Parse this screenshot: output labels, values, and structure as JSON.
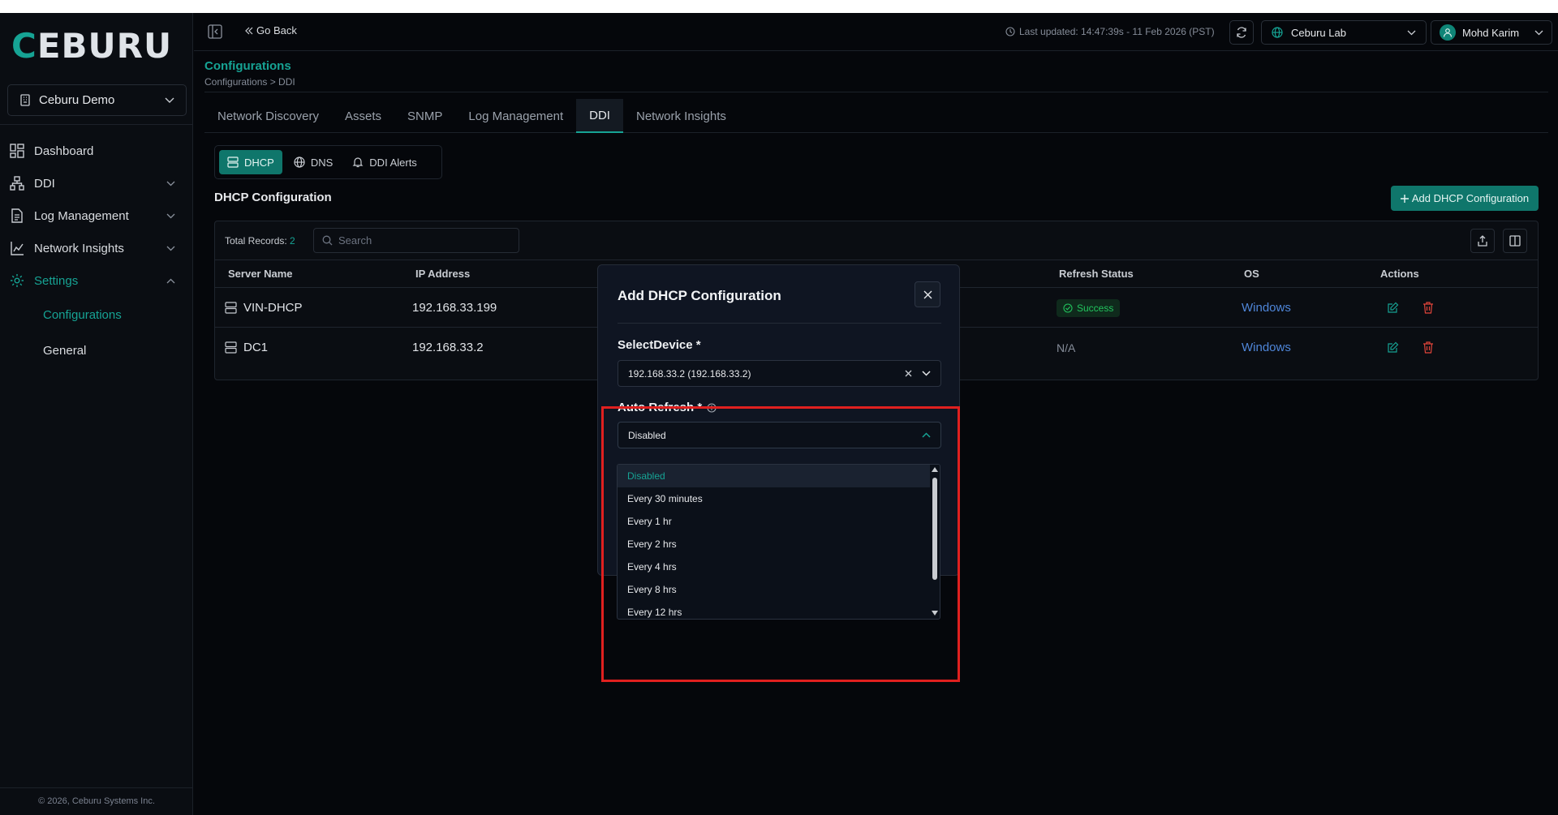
{
  "sidebar": {
    "logo": {
      "lead": "C",
      "rest": "EBURU"
    },
    "org": "Ceburu Demo",
    "nav": [
      {
        "label": "Dashboard"
      },
      {
        "label": "DDI"
      },
      {
        "label": "Log Management"
      },
      {
        "label": "Network Insights"
      },
      {
        "label": "Settings"
      }
    ],
    "sub": [
      {
        "label": "Configurations"
      },
      {
        "label": "General"
      }
    ],
    "copyright": "© 2026, Ceburu Systems Inc."
  },
  "topbar": {
    "go_back": "Go Back",
    "last_updated": "Last updated: 14:47:39s - 11 Feb 2026 (PST)",
    "lab": "Ceburu Lab",
    "user": "Mohd Karim"
  },
  "page": {
    "title": "Configurations",
    "breadcrumb": "Configurations > DDI"
  },
  "tabs": [
    {
      "label": "Network Discovery"
    },
    {
      "label": "Assets"
    },
    {
      "label": "SNMP"
    },
    {
      "label": "Log Management"
    },
    {
      "label": "DDI"
    },
    {
      "label": "Network Insights"
    }
  ],
  "subtabs": [
    {
      "label": "DHCP"
    },
    {
      "label": "DNS"
    },
    {
      "label": "DDI Alerts"
    }
  ],
  "section": {
    "title": "DHCP Configuration",
    "add_button": "Add DHCP Configuration"
  },
  "table": {
    "total_label": "Total Records:",
    "total_count": "2",
    "search_placeholder": "Search",
    "headers": {
      "server_name": "Server Name",
      "ip_address": "IP Address",
      "refresh_status": "Refresh Status",
      "os": "OS",
      "actions": "Actions"
    },
    "rows": [
      {
        "server_name": "VIN-DHCP",
        "ip": "192.168.33.199",
        "refresh_status": "Success",
        "os": "Windows"
      },
      {
        "server_name": "DC1",
        "ip": "192.168.33.2",
        "refresh_status": "N/A",
        "os": "Windows"
      }
    ]
  },
  "modal": {
    "title": "Add DHCP Configuration",
    "select_device_label": "SelectDevice *",
    "select_device_value": "192.168.33.2 (192.168.33.2)",
    "auto_refresh_label": "Auto Refresh *",
    "auto_refresh_value": "Disabled",
    "options": [
      "Disabled",
      "Every 30 minutes",
      "Every 1 hr",
      "Every 2 hrs",
      "Every 4 hrs",
      "Every 8 hrs",
      "Every 12 hrs"
    ]
  },
  "colors": {
    "accent": "#16a394",
    "highlight": "#e0201f",
    "link": "#4f86d9",
    "danger": "#e0443a"
  }
}
